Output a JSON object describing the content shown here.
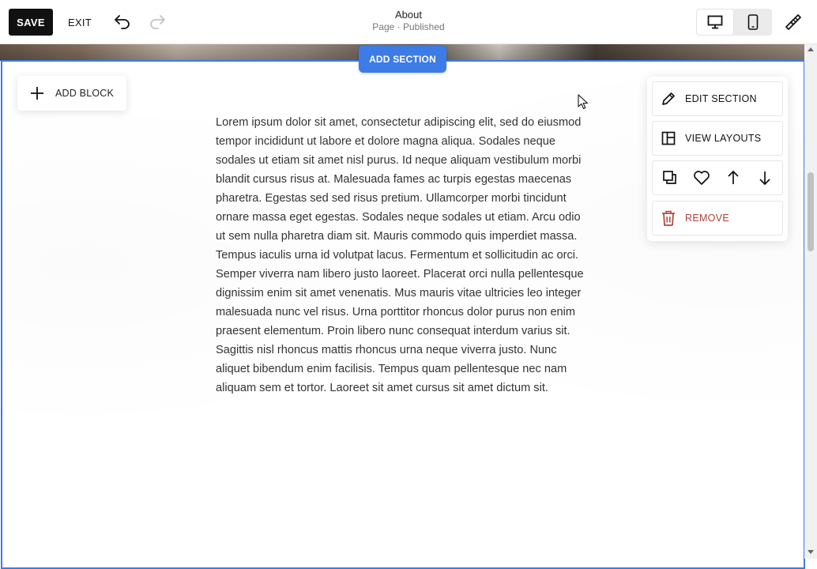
{
  "toolbar": {
    "save_label": "SAVE",
    "exit_label": "EXIT",
    "undo_icon": "undo-icon",
    "redo_icon": "redo-icon",
    "page_title": "About",
    "page_status": "Page · Published",
    "device_options": [
      "desktop",
      "mobile"
    ],
    "selected_device": "desktop",
    "design_icon": "paintbrush-icon"
  },
  "editor": {
    "add_section_label": "ADD SECTION",
    "add_block_label": "ADD BLOCK",
    "body_text": "Lorem ipsum dolor sit amet, consectetur adipiscing elit, sed do eiusmod tempor incididunt ut labore et dolore magna aliqua. Sodales neque sodales ut etiam sit amet nisl purus. Id neque aliquam vestibulum morbi blandit cursus risus at. Malesuada fames ac turpis egestas maecenas pharetra. Egestas sed sed risus pretium. Ullamcorper morbi tincidunt ornare massa eget egestas. Sodales neque sodales ut etiam. Arcu odio ut sem nulla pharetra diam sit. Mauris commodo quis imperdiet massa. Tempus iaculis urna id volutpat lacus. Fermentum et sollicitudin ac orci. Semper viverra nam libero justo laoreet. Placerat orci nulla pellentesque dignissim enim sit amet venenatis. Mus mauris vitae ultricies leo integer malesuada nunc vel risus. Urna porttitor rhoncus dolor purus non enim praesent elementum. Proin libero nunc consequat interdum varius sit. Sagittis nisl rhoncus mattis rhoncus urna neque viverra justo. Nunc aliquet bibendum enim facilisis. Tempus quam pellentesque nec nam aliquam sem et tortor. Laoreet sit amet cursus sit amet dictum sit."
  },
  "section_tools": {
    "edit_label": "EDIT SECTION",
    "layouts_label": "VIEW LAYOUTS",
    "remove_label": "REMOVE",
    "icons": [
      "duplicate-icon",
      "heart-icon",
      "arrow-up-icon",
      "arrow-down-icon"
    ]
  },
  "colors": {
    "accent": "#3d7be6",
    "remove": "#b0433a",
    "save_bg": "#111111"
  }
}
